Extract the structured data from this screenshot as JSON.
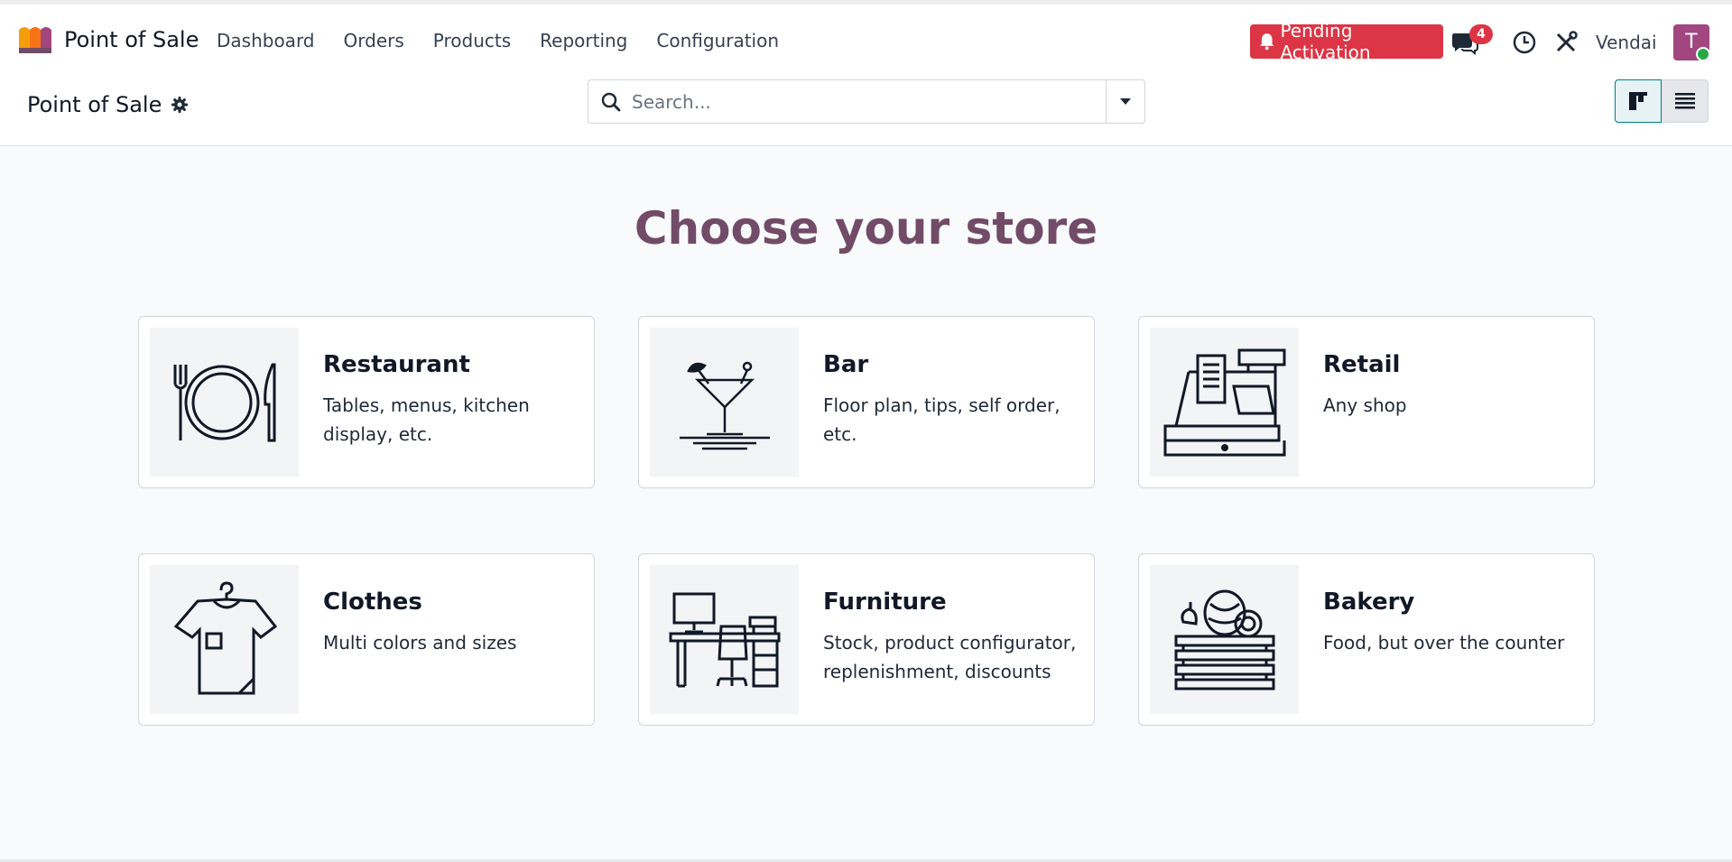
{
  "app": {
    "name": "Point of Sale"
  },
  "top_menu": [
    {
      "label": "Dashboard"
    },
    {
      "label": "Orders"
    },
    {
      "label": "Products"
    },
    {
      "label": "Reporting"
    },
    {
      "label": "Configuration"
    }
  ],
  "systray": {
    "pending_label": "Pending Activation",
    "messages_count": "4",
    "user_name": "Vendai",
    "avatar_initial": "T"
  },
  "control_panel": {
    "breadcrumb_title": "Point of Sale",
    "search_placeholder": "Search..."
  },
  "main": {
    "title": "Choose your store",
    "stores": [
      {
        "title": "Restaurant",
        "description": "Tables, menus, kitchen display, etc.",
        "icon": "restaurant-icon"
      },
      {
        "title": "Bar",
        "description": "Floor plan, tips, self order, etc.",
        "icon": "cocktail-icon"
      },
      {
        "title": "Retail",
        "description": "Any shop",
        "icon": "cash-register-icon"
      },
      {
        "title": "Clothes",
        "description": "Multi colors and sizes",
        "icon": "tshirt-icon"
      },
      {
        "title": "Furniture",
        "description": "Stock, product configurator, replenishment, discounts",
        "icon": "desk-icon"
      },
      {
        "title": "Bakery",
        "description": "Food, but over the counter",
        "icon": "bread-basket-icon"
      }
    ]
  },
  "colors": {
    "brand_purple": "#714b67",
    "danger": "#dc3545",
    "teal": "#017e84",
    "avatar": "#a2467f"
  }
}
